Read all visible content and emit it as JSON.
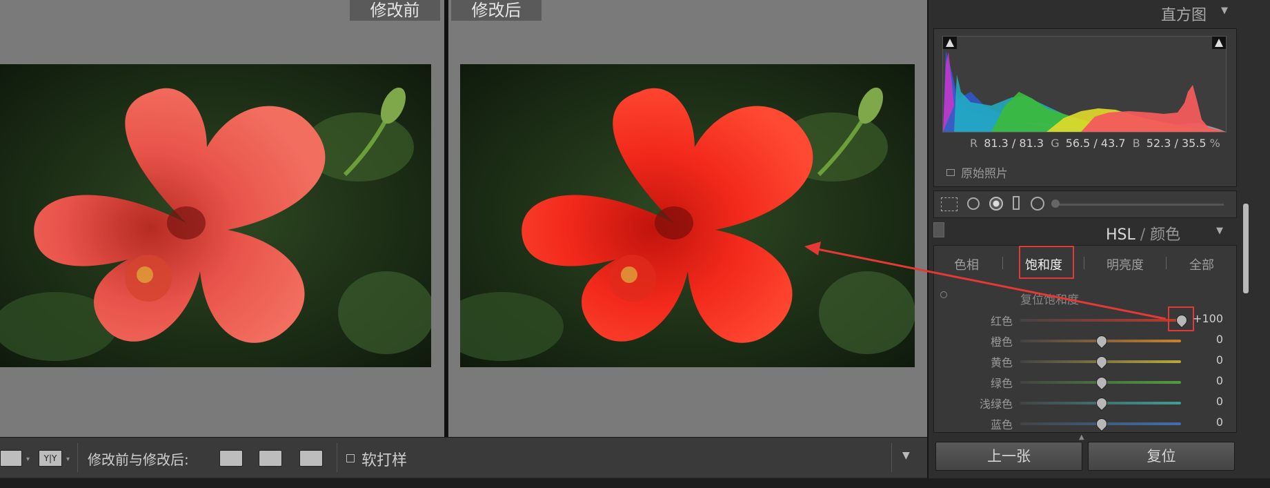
{
  "compare": {
    "before_label": "修改前",
    "after_label": "修改后"
  },
  "toolbar": {
    "view_a_icon": "ab-view-icon",
    "view_yy_label": "Y|Y",
    "compare_label": "修改前与修改后:",
    "soft_proof_label": "软打样"
  },
  "histogram": {
    "title": "直方图",
    "values_r_label": "R",
    "values_r": "81.3 /  81.3",
    "values_g_label": "G",
    "values_g": "56.5 /  43.7",
    "values_b_label": "B",
    "values_b": "52.3 /  35.5",
    "values_unit": "%",
    "original_label": "原始照片"
  },
  "hsl": {
    "title_hsl": "HSL",
    "title_sep": " / ",
    "title_color": "颜色",
    "tabs": [
      "色相",
      "饱和度",
      "明亮度",
      "全部"
    ],
    "reset_label": "复位饱和度",
    "rows": [
      {
        "label": "红色",
        "value": "+100",
        "level": 1.0,
        "color": "#c0392b"
      },
      {
        "label": "橙色",
        "value": "0",
        "level": 0.5,
        "color": "#c9822e"
      },
      {
        "label": "黄色",
        "value": "0",
        "level": 0.5,
        "color": "#b9a83a"
      },
      {
        "label": "绿色",
        "value": "0",
        "level": 0.5,
        "color": "#4f9e3c"
      },
      {
        "label": "浅绿色",
        "value": "0",
        "level": 0.5,
        "color": "#3e9f95"
      },
      {
        "label": "蓝色",
        "value": "0",
        "level": 0.5,
        "color": "#3f6fb0"
      }
    ]
  },
  "buttons": {
    "prev": "上一张",
    "reset": "复位"
  },
  "colors": {
    "accent_red": "#e53935"
  }
}
